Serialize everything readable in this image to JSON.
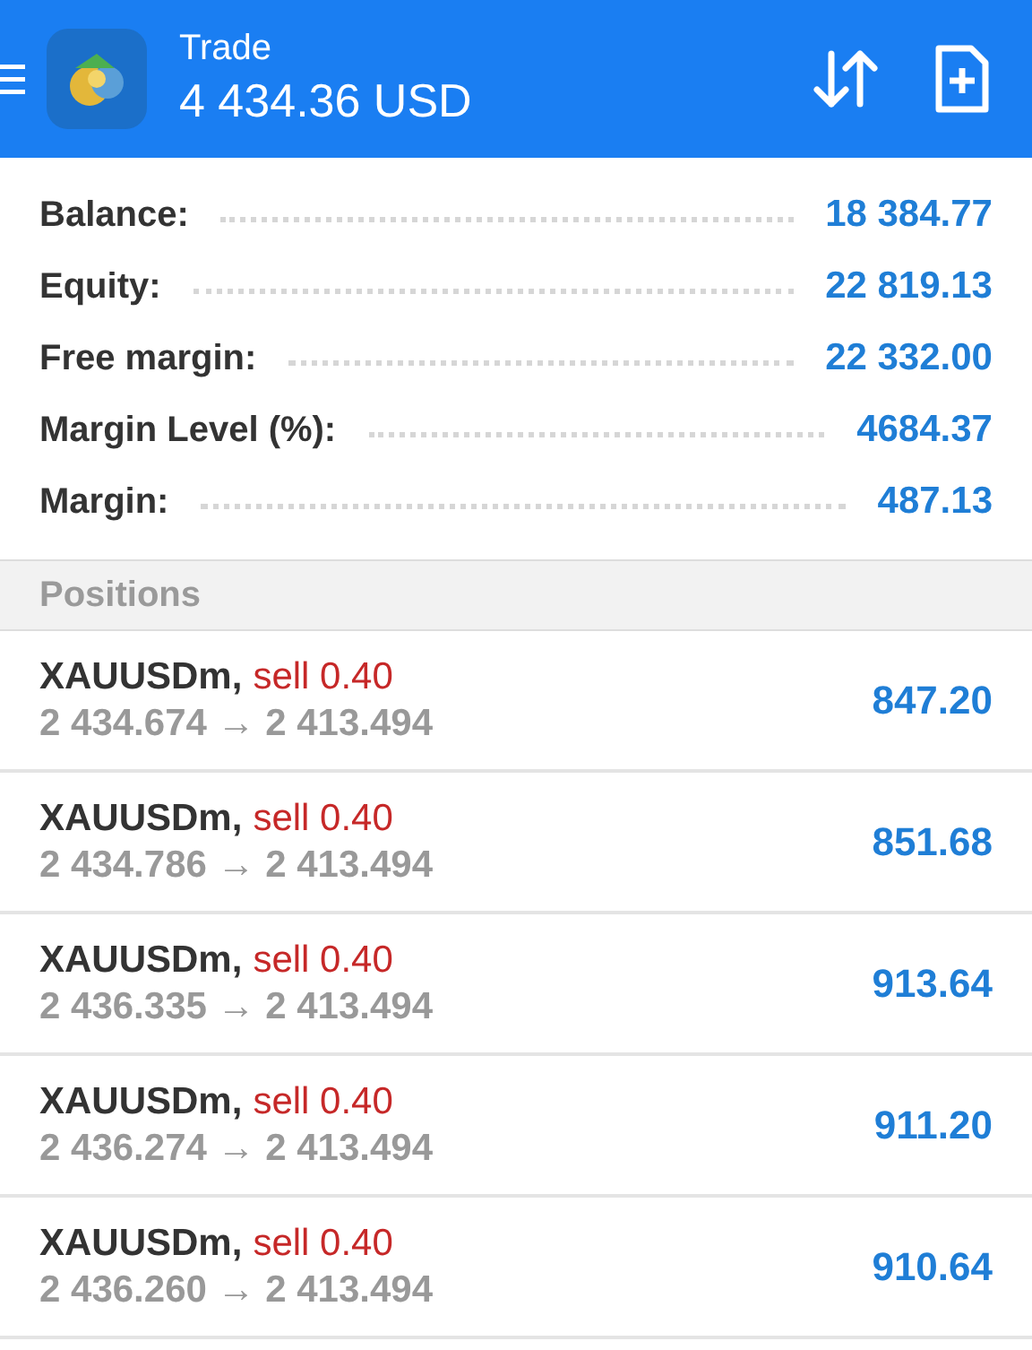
{
  "header": {
    "title": "Trade",
    "balance": "4 434.36 USD"
  },
  "summary": [
    {
      "label": "Balance:",
      "value": "18 384.77"
    },
    {
      "label": "Equity:",
      "value": "22 819.13"
    },
    {
      "label": "Free margin:",
      "value": "22 332.00"
    },
    {
      "label": "Margin Level (%):",
      "value": "4684.37"
    },
    {
      "label": "Margin:",
      "value": "487.13"
    }
  ],
  "positions_header": "Positions",
  "positions": [
    {
      "symbol": "XAUUSDm,",
      "side": "sell 0.40",
      "prices": "2 434.674 → 2 413.494",
      "profit": "847.20"
    },
    {
      "symbol": "XAUUSDm,",
      "side": "sell 0.40",
      "prices": "2 434.786 → 2 413.494",
      "profit": "851.68"
    },
    {
      "symbol": "XAUUSDm,",
      "side": "sell 0.40",
      "prices": "2 436.335 → 2 413.494",
      "profit": "913.64"
    },
    {
      "symbol": "XAUUSDm,",
      "side": "sell 0.40",
      "prices": "2 436.274 → 2 413.494",
      "profit": "911.20"
    },
    {
      "symbol": "XAUUSDm,",
      "side": "sell 0.40",
      "prices": "2 436.260 → 2 413.494",
      "profit": "910.64"
    }
  ]
}
